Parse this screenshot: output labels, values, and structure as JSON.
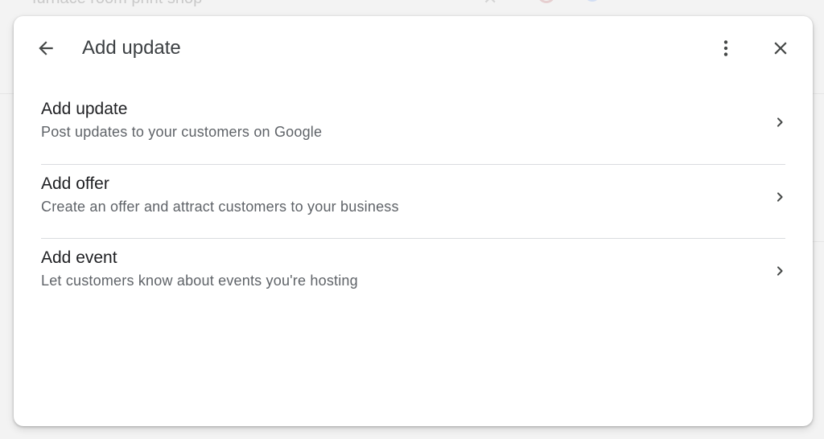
{
  "background": {
    "search_text": "furnace room print shop"
  },
  "dialog": {
    "title": "Add update",
    "icons": {
      "back": "arrow-back-icon",
      "more": "more-vert-icon",
      "close": "close-icon",
      "chevron": "chevron-right-icon"
    },
    "items": [
      {
        "title": "Add update",
        "subtitle": "Post updates to your customers on Google"
      },
      {
        "title": "Add offer",
        "subtitle": "Create an offer and attract customers to your business"
      },
      {
        "title": "Add event",
        "subtitle": "Let customers know about events you're hosting"
      }
    ]
  },
  "colors": {
    "title_text": "#3c4043",
    "primary_text": "#202124",
    "secondary_text": "#5f6368",
    "divider": "#dadce0",
    "icon": "#444746"
  }
}
